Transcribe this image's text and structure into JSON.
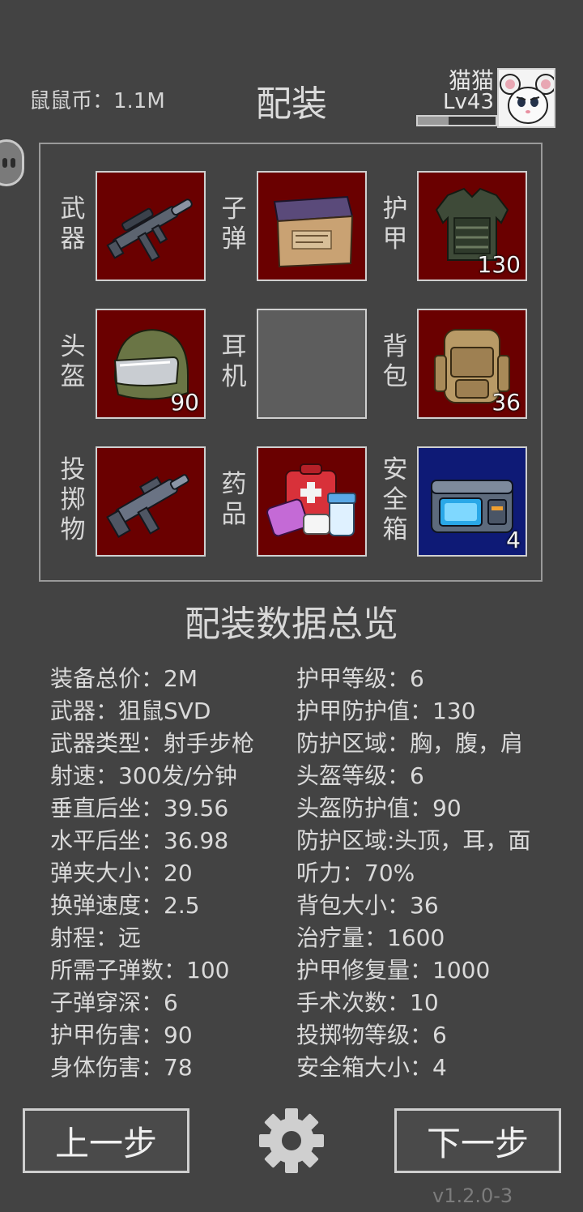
{
  "header": {
    "coins_text": "鼠鼠币：1.1M",
    "title": "配装",
    "player_name": "猫猫",
    "player_level": "Lv43",
    "xp_progress": 0.4
  },
  "slots": [
    {
      "label": "武器",
      "icon": "rifle-icon",
      "count": ""
    },
    {
      "label": "子弹",
      "icon": "ammo-box-icon",
      "count": ""
    },
    {
      "label": "护甲",
      "icon": "body-armor-icon",
      "count": "130"
    },
    {
      "label": "头盔",
      "icon": "helmet-icon",
      "count": "90"
    },
    {
      "label": "耳机",
      "icon": "",
      "count": ""
    },
    {
      "label": "背包",
      "icon": "backpack-icon",
      "count": "36"
    },
    {
      "label": "投掷物",
      "icon": "launcher-icon",
      "count": ""
    },
    {
      "label": "药品",
      "icon": "medkit-icon",
      "count": ""
    },
    {
      "label": "安全箱",
      "icon": "safe-case-icon",
      "count": "4"
    }
  ],
  "summary": {
    "title": "配装数据总览",
    "left": [
      "装备总价：2M",
      "武器：狙鼠SVD",
      "武器类型：射手步枪",
      "射速：300发/分钟",
      "垂直后坐：39.56",
      "水平后坐：36.98",
      "弹夹大小：20",
      "换弹速度：2.5",
      "射程：远",
      "所需子弹数：100",
      "子弹穿深：6",
      "护甲伤害：90",
      "身体伤害：78"
    ],
    "right": [
      "护甲等级：6",
      "护甲防护值：130",
      "防护区域：胸，腹，肩",
      "头盔等级：6",
      "头盔防护值：90",
      "防护区域:头顶，耳，面",
      "听力：70%",
      "背包大小：36",
      "治疗量：1600",
      "护甲修复量：1000",
      "手术次数：10",
      "投掷物等级：6",
      "安全箱大小：4"
    ]
  },
  "footer": {
    "prev_label": "上一步",
    "next_label": "下一步",
    "version": "v1.2.0-3"
  },
  "colors": {
    "background": "#434343",
    "slot_red": "#6a0000",
    "slot_blue": "#0e1a76",
    "slot_empty": "#5d5d5d"
  }
}
